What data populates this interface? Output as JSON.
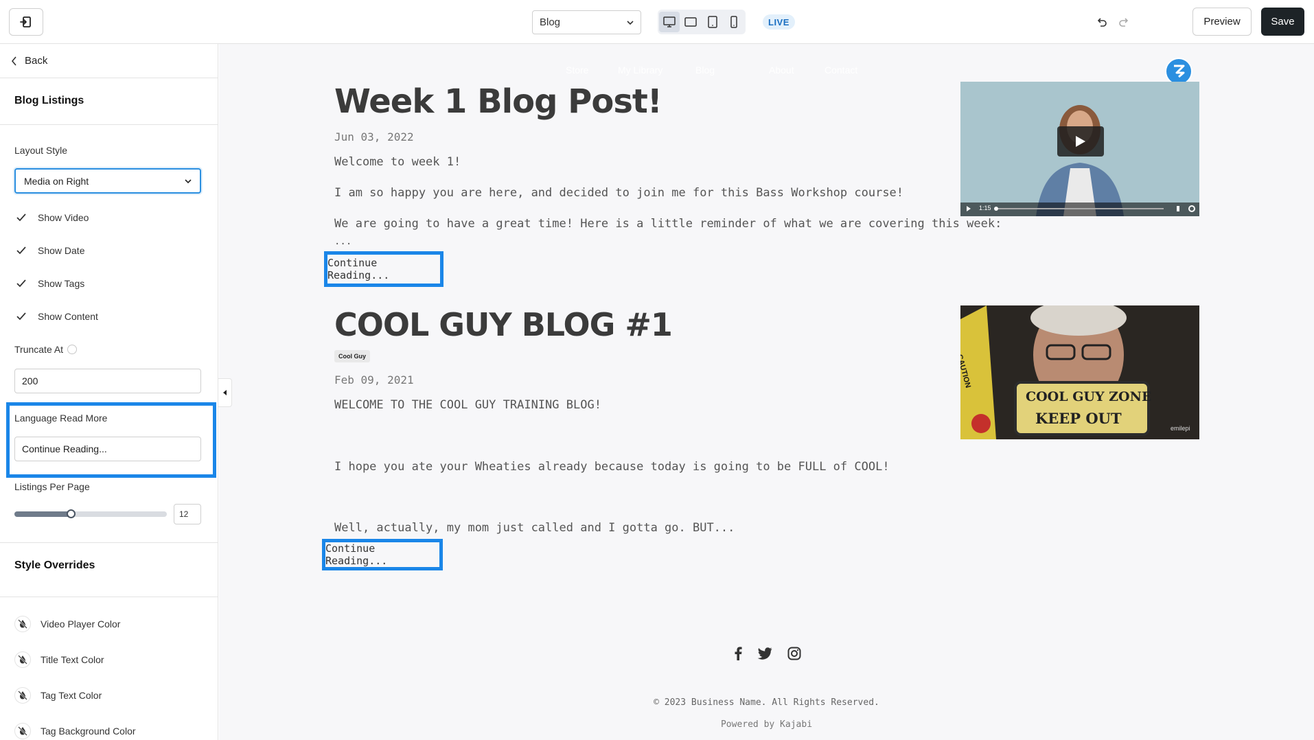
{
  "topbar": {
    "page_select_value": "Blog",
    "live_label": "LIVE",
    "preview_label": "Preview",
    "save_label": "Save"
  },
  "sidebar": {
    "back_label": "Back",
    "section_title": "Blog Listings",
    "layout_style_label": "Layout Style",
    "layout_style_value": "Media on Right",
    "checkboxes": [
      {
        "label": "Show Video",
        "checked": true
      },
      {
        "label": "Show Date",
        "checked": true
      },
      {
        "label": "Show Tags",
        "checked": true
      },
      {
        "label": "Show Content",
        "checked": true
      }
    ],
    "truncate_label": "Truncate At",
    "truncate_value": "200",
    "read_more_label": "Language Read More",
    "read_more_value": "Continue Reading...",
    "listings_label": "Listings Per Page",
    "listings_value": "12",
    "listings_fraction": 0.37,
    "style_overrides_title": "Style Overrides",
    "color_overrides": [
      {
        "label": "Video Player Color"
      },
      {
        "label": "Title Text Color"
      },
      {
        "label": "Tag Text Color"
      },
      {
        "label": "Tag Background Color"
      }
    ]
  },
  "canvas": {
    "nav": [
      "Store",
      "My Library",
      "Blog",
      "About",
      "Contact"
    ],
    "posts": [
      {
        "title": "Week 1 Blog Post!",
        "date": "Jun 03, 2022",
        "paragraphs": [
          "Welcome to week 1!",
          "I am so happy you are here, and decided to join me for this Bass Workshop course!",
          "We are going to have a great time! Here is a little reminder of what we are covering this week:",
          "..."
        ],
        "read_more": "Continue Reading...",
        "video_time": "1:15"
      },
      {
        "title": "COOL GUY BLOG #1",
        "tag": "Cool Guy",
        "date": "Feb 09, 2021",
        "paragraphs": [
          "WELCOME TO THE COOL GUY TRAINING BLOG!",
          "I hope you ate your Wheaties already because today is going to be FULL of COOL!",
          "Well, actually, my mom just called and I gotta go. BUT..."
        ],
        "read_more": "Continue Reading...",
        "image_sign_line1": "COOL GUY ZONE",
        "image_sign_line2": "KEEP OUT",
        "image_caution": "CAUTION",
        "image_watermark": "emilepi"
      }
    ],
    "footer_copy": "© 2023 Business Name. All Rights Reserved.",
    "footer_powered": "Powered by Kajabi"
  },
  "colors": {
    "accent": "#1a86e8",
    "save_bg": "#1d2327",
    "live_text": "#1b6fc2"
  }
}
